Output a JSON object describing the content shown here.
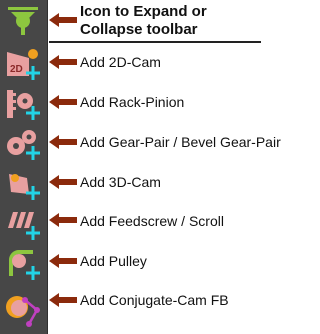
{
  "toolbar": {
    "buttons": [
      {
        "id": "expand-collapse",
        "icon": "expand-collapse-icon"
      },
      {
        "id": "add-2d-cam",
        "icon": "2d-cam-icon",
        "icon_text": "2D"
      },
      {
        "id": "add-rack-pinion",
        "icon": "rack-pinion-icon"
      },
      {
        "id": "add-gear-pair",
        "icon": "gear-pair-icon"
      },
      {
        "id": "add-3d-cam",
        "icon": "3d-cam-icon"
      },
      {
        "id": "add-feedscrew",
        "icon": "feedscrew-icon"
      },
      {
        "id": "add-pulley",
        "icon": "pulley-icon"
      },
      {
        "id": "add-conjugate-cam",
        "icon": "conjugate-cam-icon"
      }
    ]
  },
  "callouts": {
    "expand_line1": "Icon to Expand or",
    "expand_line2": "Collapse toolbar",
    "add_2d_cam": "Add 2D-Cam",
    "add_rack_pinion": "Add Rack-Pinion",
    "add_gear_pair": "Add Gear-Pair / Bevel Gear-Pair",
    "add_3d_cam": "Add 3D-Cam",
    "add_feedscrew": "Add Feedscrew / Scroll",
    "add_pulley": "Add Pulley",
    "add_conjugate_cam": "Add Conjugate-Cam FB"
  },
  "colors": {
    "toolbar_bg": "#474747",
    "icon_pink": "#e8a0a0",
    "plus_cyan": "#22d3e6",
    "expand_green": "#8dc63f",
    "arrow_brown": "#8b2a0c"
  }
}
